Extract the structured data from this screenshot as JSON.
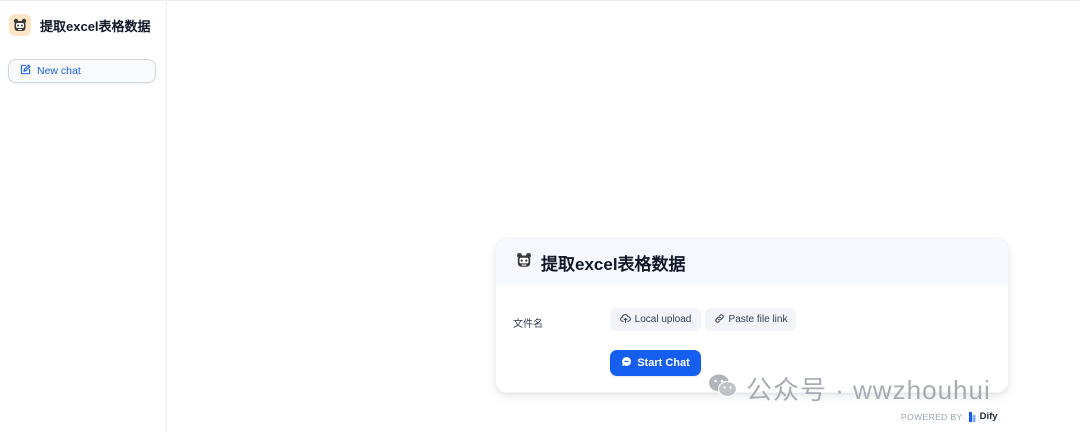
{
  "sidebar": {
    "app_title": "提取excel表格数据",
    "new_chat_label": "New chat"
  },
  "card": {
    "title": "提取excel表格数据",
    "field_label": "文件名",
    "local_upload_label": "Local upload",
    "paste_link_label": "Paste file link",
    "start_chat_label": "Start Chat"
  },
  "watermark": {
    "text": "公众号 · wwzhouhui"
  },
  "footer": {
    "powered_by": "POWERED BY",
    "brand": "Dify"
  },
  "colors": {
    "accent": "#155eef",
    "app_icon_bg": "#ffe4c6",
    "card_header_bg": "#f5f8ff"
  },
  "icons": {
    "app": "robot-face-icon",
    "new_chat": "edit-icon",
    "local_upload": "cloud-upload-icon",
    "paste_link": "link-icon",
    "start_chat": "chat-bubble-icon",
    "watermark": "wechat-icon"
  }
}
